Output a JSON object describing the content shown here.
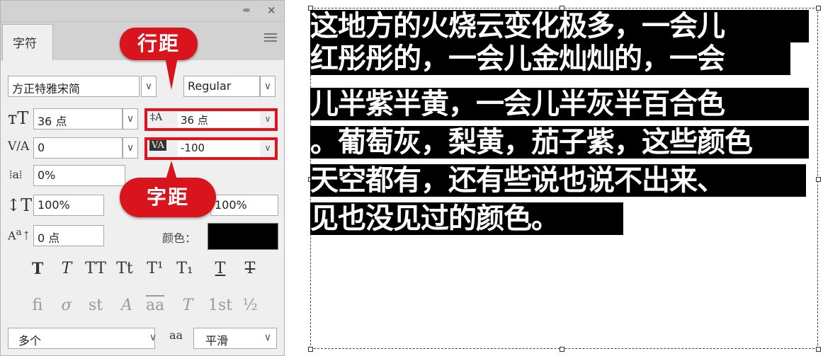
{
  "panel": {
    "collapse_glyph": "««",
    "close_glyph": "×",
    "tab_label": "字符",
    "font_family": "方正特雅宋简",
    "font_style": "Regular",
    "font_size": "36 点",
    "leading": "36 点",
    "kerning": "0",
    "tracking": "-100",
    "tsume": "0%",
    "vertical_scale": "100%",
    "horizontal_scale": "100%",
    "baseline_shift": "0 点",
    "color_label": "颜色：",
    "color_swatch": "#000000",
    "language": "多个",
    "antialias_icon": "aa",
    "antialias": "平滑",
    "style_buttons": [
      "T",
      "T",
      "TT",
      "Tt",
      "T¹",
      "T₁",
      "T",
      "T"
    ],
    "opentype_buttons": [
      "fi",
      "σ",
      "st",
      "A",
      "aa",
      "T",
      "1st",
      "½"
    ]
  },
  "callouts": {
    "leading": "行距",
    "tracking": "字距"
  },
  "canvas": {
    "lines": [
      "这地方的火烧云变化极多，一会儿",
      "红彤彤的，一会儿金灿灿的，一会",
      "儿半紫半黄，一会儿半灰半百合色",
      "。葡萄灰，梨黄，茄子紫，这些颜色",
      "天空都有，还有些说也说不出来、",
      "见也没见过的颜色。"
    ]
  },
  "colors": {
    "highlight_red": "#e0141e",
    "callout_red": "#d9141c",
    "panel_bg": "#efefef"
  }
}
